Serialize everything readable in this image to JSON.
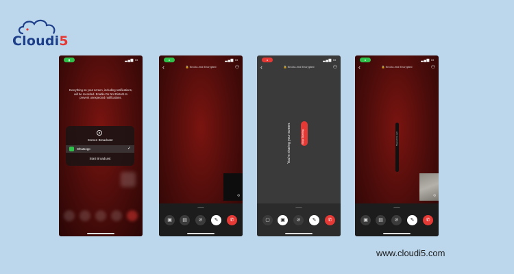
{
  "brand": {
    "name_main": "Cloudi",
    "name_accent": "5",
    "website": "www.cloudi5.com"
  },
  "colors": {
    "background": "#bcd6ec",
    "brand_blue": "#1d3f8a",
    "accent_red": "#e53935",
    "pill_green": "#2ec24a"
  },
  "phone1": {
    "broadcast_text": "Everything on your screen, including notifications, will be recorded. Enable Do Not Disturb to prevent unexpected notifications.",
    "sheet_title": "Screen Broadcast",
    "app_option": "WhatsApp",
    "start_label": "Start Broadcast"
  },
  "phone2": {
    "encryption_label": "End-to-end Encrypted"
  },
  "phone3": {
    "encryption_label": "End-to-end Encrypted",
    "sharing_text": "You're sharing your screen.",
    "stop_label": "Stop Sharing"
  },
  "phone4": {
    "encryption_label": "End-to-end Encrypted",
    "screen_label": "Shared this call"
  },
  "icons": [
    "back-chevron-icon",
    "lock-icon",
    "add-user-icon",
    "flip-camera-icon",
    "screen-share-icon",
    "video-off-icon",
    "mute-icon",
    "end-call-icon"
  ]
}
